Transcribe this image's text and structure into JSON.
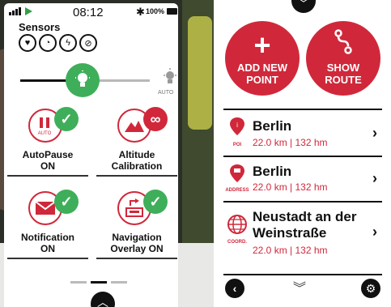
{
  "status_bar": {
    "time": "08:12",
    "battery": "100%",
    "icons": [
      "signal-icon",
      "play-icon",
      "bluetooth-icon",
      "battery-icon"
    ]
  },
  "sensors": {
    "title": "Sensors",
    "icons": [
      "heart-rate-icon",
      "speed-sensor-icon",
      "power-icon",
      "cadence-icon"
    ]
  },
  "brightness": {
    "level": 0.45,
    "auto_label": "AUTO"
  },
  "tiles": [
    {
      "label_line1": "AutoPause",
      "label_line2": "ON",
      "icon": "pause-icon",
      "sub": "AUTO",
      "badge": "check-icon",
      "badge_color": "#3fae5a"
    },
    {
      "label_line1": "Altitude",
      "label_line2": "Calibration",
      "icon": "mountain-icon",
      "badge": "infinity-icon",
      "badge_color": "#d0283a"
    },
    {
      "label_line1": "Notification",
      "label_line2": "ON",
      "icon": "envelope-icon",
      "badge": "check-icon",
      "badge_color": "#3fae5a"
    },
    {
      "label_line1": "Navigation",
      "label_line2": "Overlay ON",
      "icon": "overlay-icon",
      "badge": "check-icon",
      "badge_color": "#3fae5a"
    }
  ],
  "actions": {
    "add_point": {
      "line1": "ADD NEW",
      "line2": "POINT",
      "icon": "plus-icon"
    },
    "show_route": {
      "line1": "SHOW",
      "line2": "ROUTE",
      "icon": "route-icon"
    }
  },
  "points": [
    {
      "name_line1": "Berlin",
      "name_line2": "",
      "distance": "22.0 km | 132 hm",
      "tag": "POI",
      "icon": "poi-pin-icon"
    },
    {
      "name_line1": "Berlin",
      "name_line2": "",
      "distance": "22.0 km | 132 hm",
      "tag": "ADDRESS",
      "icon": "address-pin-icon"
    },
    {
      "name_line1": "Neustadt an der",
      "name_line2": "Weinstraße",
      "distance": "22.0 km | 132 hm",
      "tag": "COORD.",
      "icon": "globe-icon"
    }
  ],
  "colors": {
    "accent_red": "#d0283a",
    "accent_green": "#3fae5a",
    "text": "#111111"
  }
}
